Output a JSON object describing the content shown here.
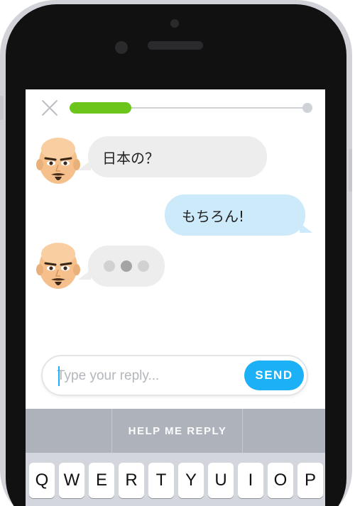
{
  "header": {
    "close_icon": "close-x-icon",
    "progress": 0.26,
    "progress_color": "#6cc51a"
  },
  "chat": {
    "messages": [
      {
        "sender": "bot",
        "text": "日本の？"
      },
      {
        "sender": "user",
        "text": "もちろん!"
      },
      {
        "sender": "bot",
        "typing": true
      }
    ]
  },
  "input": {
    "placeholder": "Type your reply...",
    "value": "",
    "send_label": "SEND"
  },
  "help": {
    "label": "HELP ME REPLY"
  },
  "keyboard": {
    "keys": [
      "Q",
      "W",
      "E",
      "R",
      "T",
      "Y",
      "U",
      "I",
      "O",
      "P"
    ]
  },
  "colors": {
    "accent": "#1cb0f6",
    "progress": "#6cc51a",
    "incoming_bubble": "#ededed",
    "outgoing_bubble": "#cdeafb"
  }
}
